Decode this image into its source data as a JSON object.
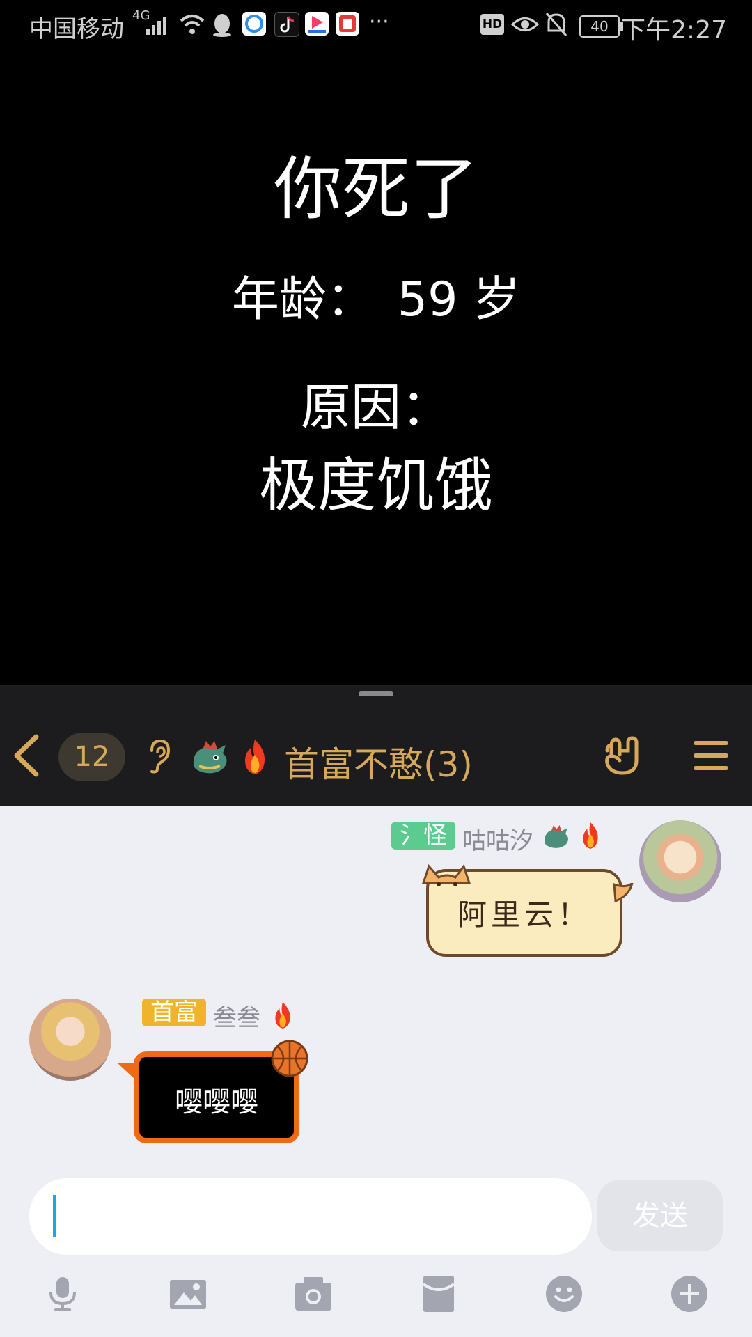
{
  "status_bar": {
    "carrier": "中国移动",
    "network": "4G",
    "time": "下午2:27",
    "battery": "40",
    "hd": "HD",
    "more": "···"
  },
  "game": {
    "title": "你死了",
    "age_label": "年龄：",
    "age_value": "59 岁",
    "cause_label": "原因：",
    "cause_value": "极度饥饿"
  },
  "header": {
    "unread_count": "12",
    "title": "首富不憨(3)",
    "accent_color": "#d7a85a"
  },
  "messages": [
    {
      "side": "right",
      "tag": "氵怪",
      "nickname": "咕咕汐",
      "text": "阿里云！"
    },
    {
      "side": "left",
      "tag": "首富",
      "nickname": "叁叁",
      "text": "嘤嘤嘤"
    }
  ],
  "input": {
    "value": "",
    "send_label": "发送"
  },
  "toolbar": [
    "mic-icon",
    "image-icon",
    "camera-icon",
    "red-packet-icon",
    "emoji-icon",
    "plus-icon"
  ]
}
